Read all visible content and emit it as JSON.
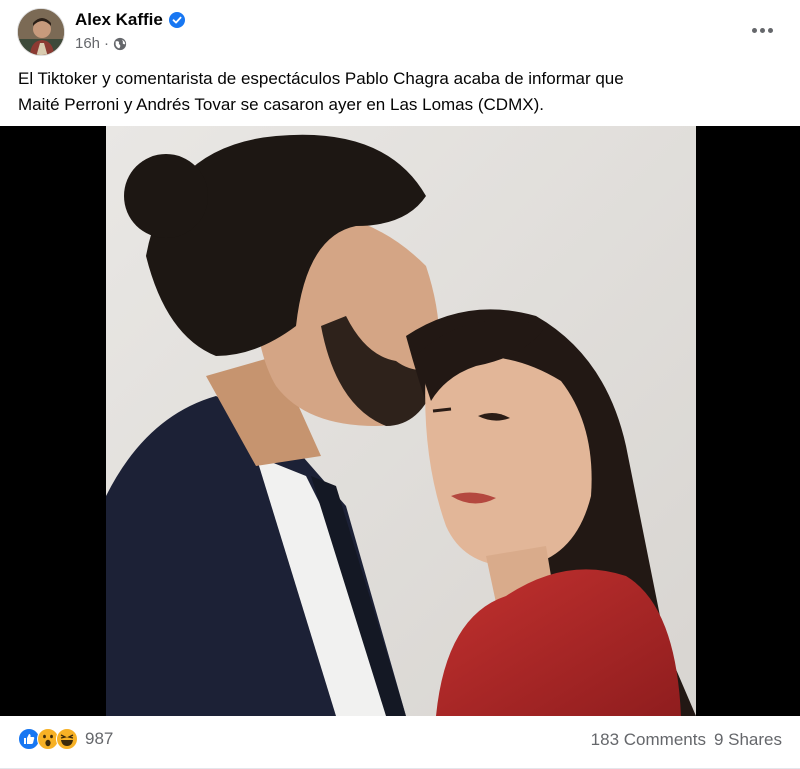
{
  "post": {
    "author": "Alex Kaffie",
    "time": "16h",
    "separator": "·",
    "text_line1": "El Tiktoker y comentarista de espectáculos Pablo Chagra acaba de informar que",
    "text_line2": "Maité Perroni y Andrés Tovar se casaron ayer en Las Lomas (CDMX).",
    "icons": {
      "verified": "verified-badge-icon",
      "privacy": "globe-icon",
      "more": "more-options-icon"
    },
    "colors": {
      "verified_blue": "#1877f2",
      "secondary_text": "#65676b"
    }
  },
  "footer": {
    "reaction_count": "987",
    "comments": "183 Comments",
    "shares": "9 Shares",
    "reaction_icons": [
      "like-reaction-icon",
      "wow-reaction-icon",
      "haha-reaction-icon"
    ]
  }
}
